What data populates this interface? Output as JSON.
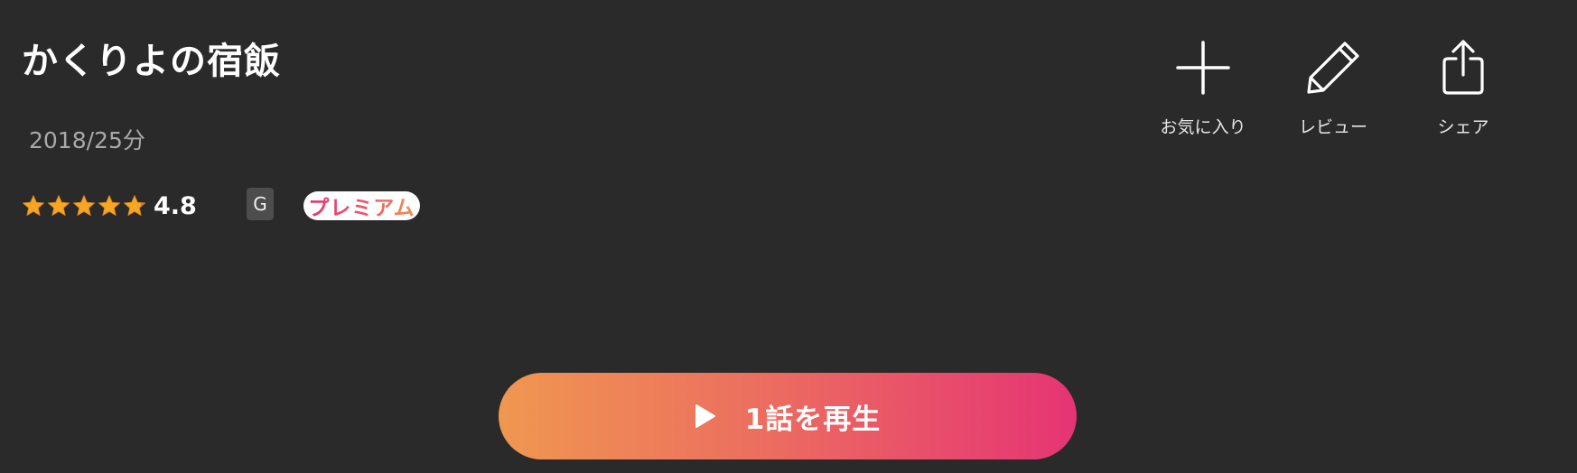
{
  "program": {
    "title": "かくりよの宿飯",
    "meta": "2018/25分",
    "rating": {
      "value": "4.8",
      "stars_filled": 4.8,
      "stars_total": 5
    },
    "age_rating": "G",
    "badge": "プレミアム"
  },
  "actions": [
    {
      "label": "お気に入り",
      "icon": "plus-icon"
    },
    {
      "label": "レビュー",
      "icon": "pencil-icon"
    },
    {
      "label": "シェア",
      "icon": "share-icon"
    }
  ],
  "play_button": {
    "label": "1話を再生",
    "icon": "play-icon"
  },
  "colors": {
    "background": "#2a2a2a",
    "gradient_start": "#ef9750",
    "gradient_end": "#e53474",
    "star_gold": "#f6a623",
    "age_badge_bg": "#4d4d4d"
  }
}
